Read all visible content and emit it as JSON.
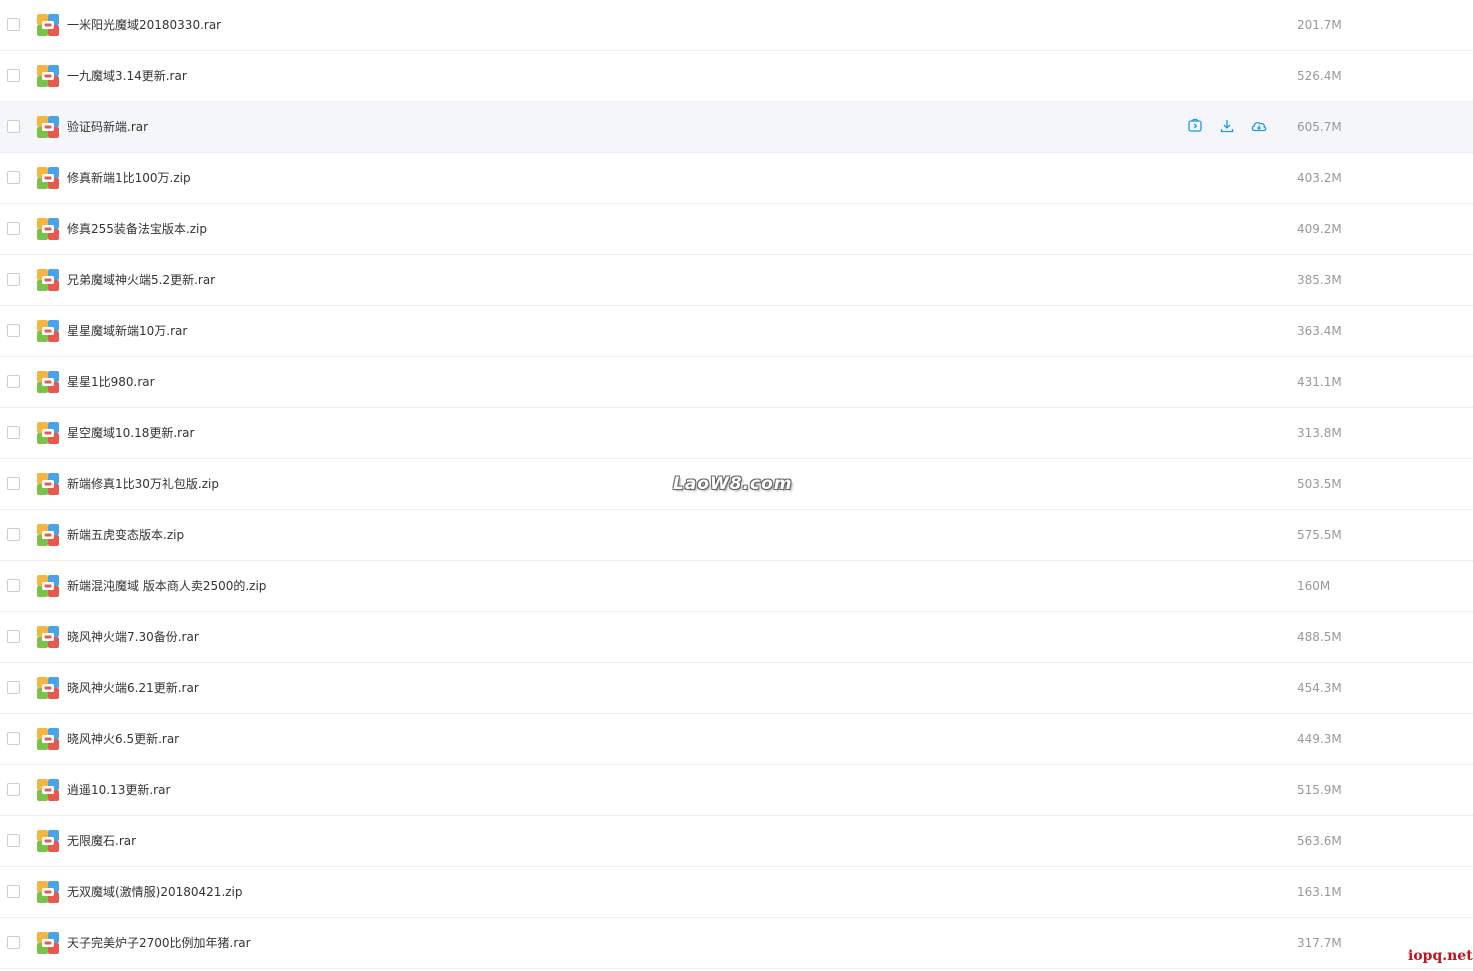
{
  "files": [
    {
      "name": "一米阳光魔域20180330.rar",
      "size": "201.7M"
    },
    {
      "name": "一九魔域3.14更新.rar",
      "size": "526.4M"
    },
    {
      "name": "验证码新端.rar",
      "size": "605.7M",
      "hovered": true
    },
    {
      "name": "修真新端1比100万.zip",
      "size": "403.2M"
    },
    {
      "name": "修真255装备法宝版本.zip",
      "size": "409.2M"
    },
    {
      "name": "兄弟魔域神火端5.2更新.rar",
      "size": "385.3M"
    },
    {
      "name": "星星魔域新端10万.rar",
      "size": "363.4M"
    },
    {
      "name": "星星1比980.rar",
      "size": "431.1M"
    },
    {
      "name": "星空魔域10.18更新.rar",
      "size": "313.8M"
    },
    {
      "name": "新端修真1比30万礼包版.zip",
      "size": "503.5M"
    },
    {
      "name": "新端五虎变态版本.zip",
      "size": "575.5M"
    },
    {
      "name": "新端混沌魔域 版本商人卖2500的.zip",
      "size": "160M"
    },
    {
      "name": "晓风神火端7.30备份.rar",
      "size": "488.5M"
    },
    {
      "name": "晓风神火端6.21更新.rar",
      "size": "454.3M"
    },
    {
      "name": "晓风神火6.5更新.rar",
      "size": "449.3M"
    },
    {
      "name": "逍遥10.13更新.rar",
      "size": "515.9M"
    },
    {
      "name": "无限魔石.rar",
      "size": "563.6M"
    },
    {
      "name": "无双魔域(激情服)20180421.zip",
      "size": "163.1M"
    },
    {
      "name": "天子完美炉子2700比例加年猪.rar",
      "size": "317.7M"
    }
  ],
  "row_actions": [
    {
      "icon": "share-icon"
    },
    {
      "icon": "download-icon"
    },
    {
      "icon": "cloud-save-icon"
    }
  ],
  "colors": {
    "accent": "#1a9be6",
    "row_hover": "#f5f6fa",
    "divider": "#eeeff2",
    "size_text": "#999999"
  },
  "watermarks": {
    "center": "LaoW8.com",
    "corner": "iopq.net"
  }
}
